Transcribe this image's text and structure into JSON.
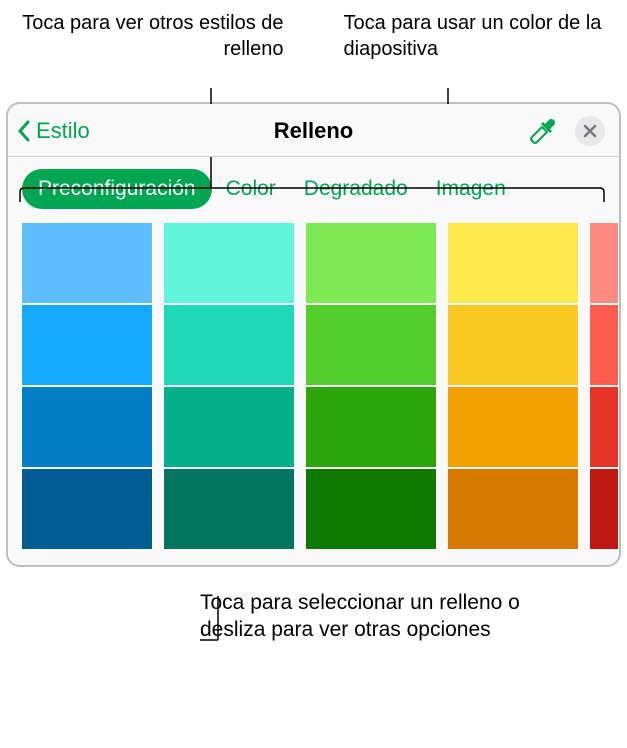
{
  "annotations": {
    "top_left": "Toca para ver otros estilos de relleno",
    "top_right": "Toca para usar un color de la diapositiva",
    "bottom": "Toca para seleccionar un relleno o desliza para ver otras opciones"
  },
  "header": {
    "back_label": "Estilo",
    "title": "Relleno"
  },
  "tabs": {
    "preset": "Preconfiguración",
    "color": "Color",
    "gradient": "Degradado",
    "image": "Imagen"
  },
  "swatches": {
    "columns": [
      {
        "name": "blue",
        "colors": [
          "#5ebdff",
          "#16aaff",
          "#017ec4",
          "#005d93"
        ]
      },
      {
        "name": "teal",
        "colors": [
          "#61f5db",
          "#1fd9b8",
          "#04b089",
          "#01755e"
        ]
      },
      {
        "name": "green",
        "colors": [
          "#7ce955",
          "#53cd2c",
          "#2ba509",
          "#0e7a00"
        ]
      },
      {
        "name": "yellow",
        "colors": [
          "#fbe94b",
          "#fac921",
          "#f2a002",
          "#d77900"
        ]
      },
      {
        "name": "red",
        "colors": [
          "#ff8a81",
          "#ff5c50",
          "#e63427",
          "#be1812"
        ],
        "partial": true
      }
    ]
  }
}
